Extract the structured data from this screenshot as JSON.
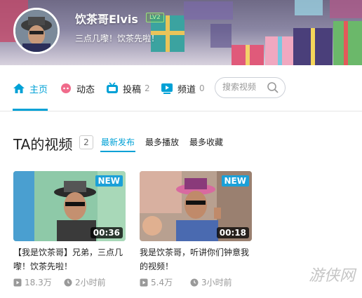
{
  "header": {
    "username": "饮茶哥Elvis",
    "level": "LV2",
    "signature": "三点几嚟！饮茶先啦！"
  },
  "nav": {
    "items": [
      {
        "label": "主页",
        "icon": "home-icon",
        "count": ""
      },
      {
        "label": "动态",
        "icon": "dynamic-icon",
        "count": ""
      },
      {
        "label": "投稿",
        "icon": "upload-tv-icon",
        "count": "2"
      },
      {
        "label": "频道",
        "icon": "channel-icon",
        "count": "0"
      }
    ],
    "search_placeholder": "搜索视频"
  },
  "section": {
    "title": "TA的视频",
    "count": "2",
    "tabs": [
      "最新发布",
      "最多播放",
      "最多收藏"
    ]
  },
  "videos": [
    {
      "badge": "NEW",
      "duration": "00:36",
      "title": "【我是饮茶哥】兄弟，三点几嚟！饮茶先啦！",
      "views": "18.3万",
      "time": "2小时前"
    },
    {
      "badge": "NEW",
      "duration": "00:18",
      "title": "我是饮茶哥，听讲你们钟意我的视频！",
      "views": "5.4万",
      "time": "3小时前"
    }
  ],
  "colors": {
    "accent": "#00a1d6",
    "new_badge": "#1ba0d8"
  },
  "watermark": "游侠网"
}
